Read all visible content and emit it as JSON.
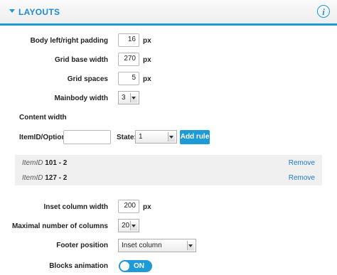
{
  "header": {
    "title": "LAYOUTS",
    "info_icon": "info-icon",
    "collapse_icon": "chevron-down-icon",
    "accent": "#1e9ad6"
  },
  "fields": {
    "body_padding": {
      "label": "Body left/right padding",
      "value": "16",
      "unit": "px"
    },
    "grid_base_width": {
      "label": "Grid base width",
      "value": "270",
      "unit": "px"
    },
    "grid_spaces": {
      "label": "Grid spaces",
      "value": "5",
      "unit": "px"
    },
    "mainbody_width": {
      "label": "Mainbody width",
      "value": "3"
    }
  },
  "content_width": {
    "title": "Content width",
    "itemid_label": "ItemID/Option:",
    "itemid_value": "",
    "state_label": "State:",
    "state_value": "1",
    "add_label": "Add rule",
    "rules": [
      {
        "prefix": "ItemID",
        "value": "101 - 2",
        "remove_label": "Remove"
      },
      {
        "prefix": "ItemID",
        "value": "127 - 2",
        "remove_label": "Remove"
      }
    ]
  },
  "inset": {
    "inset_column_width": {
      "label": "Inset column width",
      "value": "200",
      "unit": "px"
    },
    "max_columns": {
      "label": "Maximal number of columns",
      "value": "20"
    },
    "footer_position": {
      "label": "Footer position",
      "value": "Inset column"
    },
    "blocks_animation": {
      "label": "Blocks animation",
      "value": "ON"
    }
  }
}
